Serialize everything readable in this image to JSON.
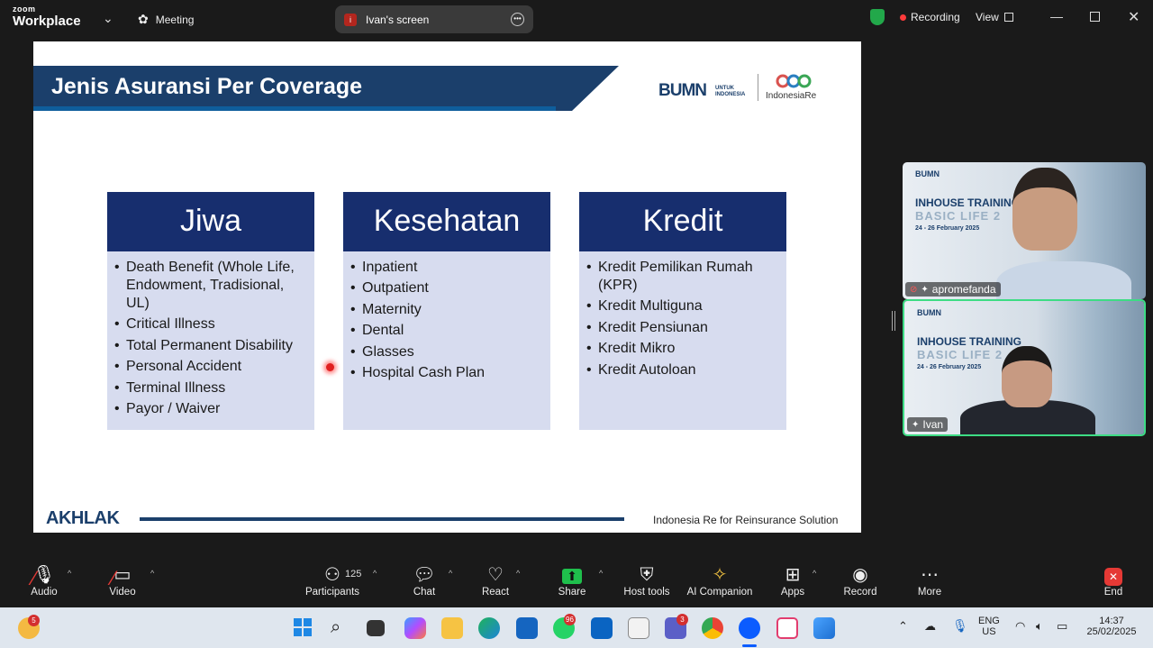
{
  "topbar": {
    "app_line1": "zoom",
    "app_line2": "Workplace",
    "meeting_label": "Meeting",
    "screen_label": "Ivan's screen",
    "recording_label": "Recording",
    "view_label": "View"
  },
  "slide": {
    "title": "Jenis Asuransi Per Coverage",
    "logo_bumn": "BUMN",
    "logo_bumn_sub1": "UNTUK",
    "logo_bumn_sub2": "INDONESIA",
    "logo_ire": "IndonesiaRe",
    "columns": [
      {
        "heading": "Jiwa",
        "items": [
          "Death Benefit (Whole Life, Endowment, Tradisional, UL)",
          "Critical Illness",
          "Total Permanent Disability",
          "Personal Accident",
          "Terminal Illness",
          "Payor / Waiver"
        ]
      },
      {
        "heading": "Kesehatan",
        "items": [
          "Inpatient",
          "Outpatient",
          "Maternity",
          "Dental",
          "Glasses",
          "Hospital Cash Plan"
        ]
      },
      {
        "heading": "Kredit",
        "items": [
          "Kredit Pemilikan Rumah (KPR)",
          "Kredit Multiguna",
          "Kredit Pensiunan",
          "Kredit Mikro",
          "Kredit Autoloan"
        ]
      }
    ],
    "footer_logo": "AKHLAK",
    "footer_text": "Indonesia Re for Reinsurance Solution"
  },
  "participants_panel": [
    {
      "name": "apromefanda",
      "bg_line0": "BUMN",
      "bg_line1": "INHOUSE TRAINING",
      "bg_line2": "BASIC LIFE 2",
      "bg_line3": "24 - 26 February 2025"
    },
    {
      "name": "Ivan",
      "bg_line0": "BUMN",
      "bg_line1": "INHOUSE TRAINING",
      "bg_line2": "BASIC LIFE 2",
      "bg_line3": "24 - 26 February 2025"
    }
  ],
  "toolbar": {
    "audio": "Audio",
    "video": "Video",
    "participants": "Participants",
    "participants_count": "125",
    "chat": "Chat",
    "react": "React",
    "share": "Share",
    "host_tools": "Host tools",
    "ai_companion": "AI Companion",
    "apps": "Apps",
    "record": "Record",
    "more": "More",
    "end": "End"
  },
  "taskbar": {
    "weather_badge": "5",
    "whatsapp_badge": "96",
    "teams_badge": "3",
    "lang1": "ENG",
    "lang2": "US",
    "time": "14:37",
    "date": "25/02/2025"
  }
}
